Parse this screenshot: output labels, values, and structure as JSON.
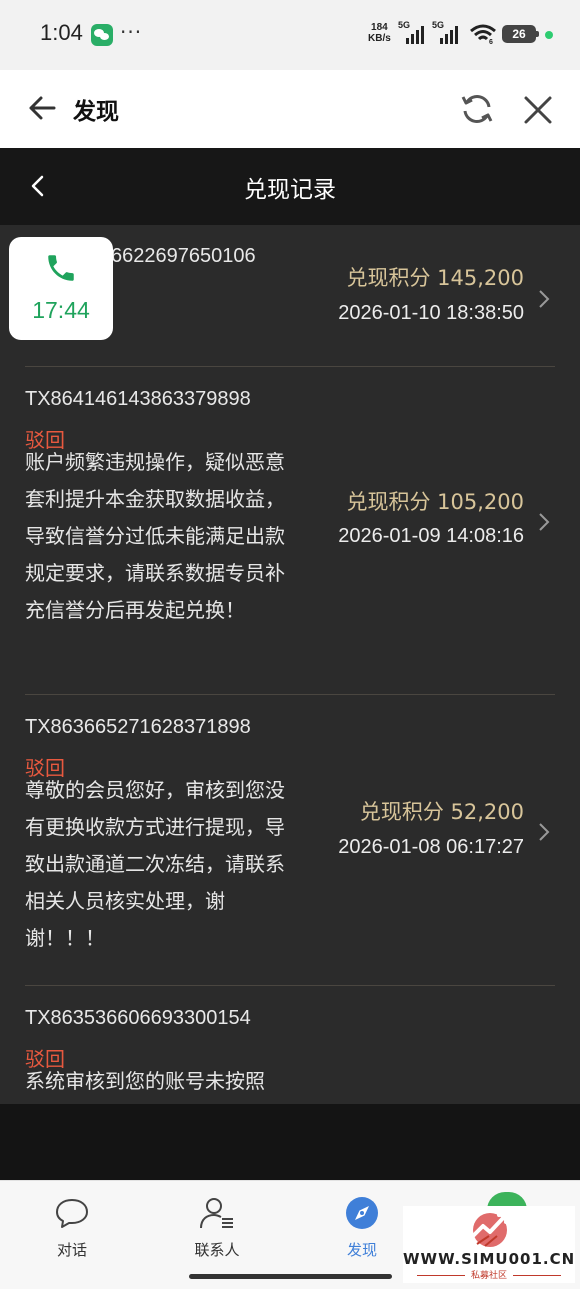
{
  "status_bar": {
    "time": "1:04",
    "dots": "···",
    "net_speed_value": "184",
    "net_speed_unit": "KB/s",
    "sim1_label": "5G",
    "sim2_label": "5G",
    "wifi_sub": "6",
    "battery": "26"
  },
  "app_header": {
    "title": "发现"
  },
  "page": {
    "title": "兑现记录",
    "records": [
      {
        "id": "TX8636622697650106",
        "id_visible": "6622697650106",
        "points": "兑现积分 145,200",
        "time": "2026-01-10 18:38:50"
      },
      {
        "id": "TX864146143863379898",
        "status": "驳回",
        "reason": "账户频繁违规操作，疑似恶意套利提升本金获取数据收益，导致信誉分过低未能满足出款规定要求，请联系数据专员补充信誉分后再发起兑换！",
        "points": "兑现积分 105,200",
        "time": "2026-01-09 14:08:16"
      },
      {
        "id": "TX863665271628371898",
        "status": "驳回",
        "reason": "尊敬的会员您好，审核到您没有更换收款方式进行提现，导致出款通道二次冻结，请联系相关人员核实处理，谢谢！！！",
        "points": "兑现积分 52,200",
        "time": "2026-01-08 06:17:27"
      },
      {
        "id": "TX863536606693300154",
        "status": "驳回",
        "reason": "系统审核到您的账号未按照"
      }
    ]
  },
  "call_widget": {
    "duration": "17:44"
  },
  "tabbar": {
    "tabs": [
      {
        "label": "对话",
        "icon": "chat-bubble-icon"
      },
      {
        "label": "联系人",
        "icon": "contacts-icon"
      },
      {
        "label": "发现",
        "icon": "compass-icon",
        "active": true
      }
    ]
  },
  "watermark": {
    "url": "WWW.SIMU001.CN",
    "sub": "私募社区"
  },
  "colors": {
    "accent_blue": "#3f7fd8",
    "status_reject": "#e8593f",
    "points_gold": "#d8c59a",
    "call_green": "#1fa35c"
  }
}
